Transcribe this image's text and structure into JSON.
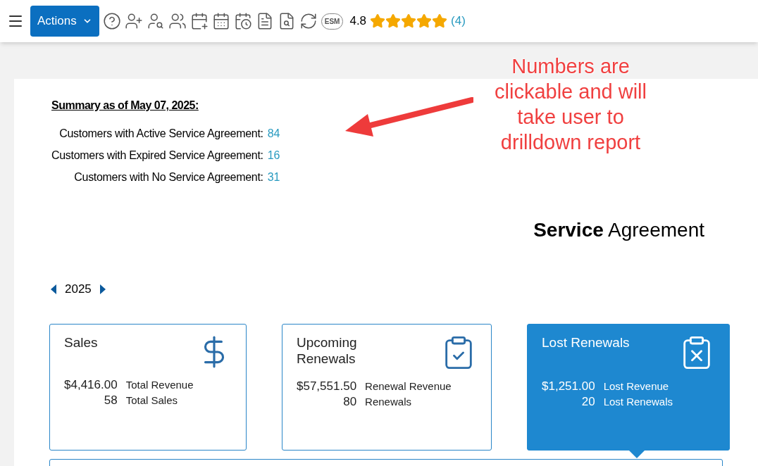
{
  "toolbar": {
    "actions_label": "Actions",
    "esm_label": "ESM",
    "rating": "4.8",
    "stars": 5,
    "review_count": "(4)"
  },
  "annotation": {
    "text": "Numbers are clickable and will take user to drilldown report"
  },
  "summary": {
    "title": "Summary as of May 07, 2025:",
    "rows": [
      {
        "label": "Customers with Active Service Agreement:",
        "value": "84"
      },
      {
        "label": "Customers with Expired Service Agreement:",
        "value": "16"
      },
      {
        "label": "Customers with No Service Agreement:",
        "value": "31"
      }
    ]
  },
  "heading": {
    "bold": "Service",
    "rest": "Agreement"
  },
  "year": "2025",
  "cards": [
    {
      "title": "Sales",
      "kind": "dollar",
      "selected": false,
      "stats": [
        {
          "amount": "$4,416.00",
          "caption": "Total Revenue"
        },
        {
          "amount": "58",
          "caption": "Total Sales"
        }
      ]
    },
    {
      "title": "Upcoming Renewals",
      "kind": "clipboard-check",
      "selected": false,
      "stats": [
        {
          "amount": "$57,551.50",
          "caption": "Renewal Revenue"
        },
        {
          "amount": "80",
          "caption": "Renewals"
        }
      ]
    },
    {
      "title": "Lost Renewals",
      "kind": "clipboard-x",
      "selected": true,
      "stats": [
        {
          "amount": "$1,251.00",
          "caption": "Lost Revenue"
        },
        {
          "amount": "20",
          "caption": "Lost Renewals"
        }
      ]
    }
  ]
}
